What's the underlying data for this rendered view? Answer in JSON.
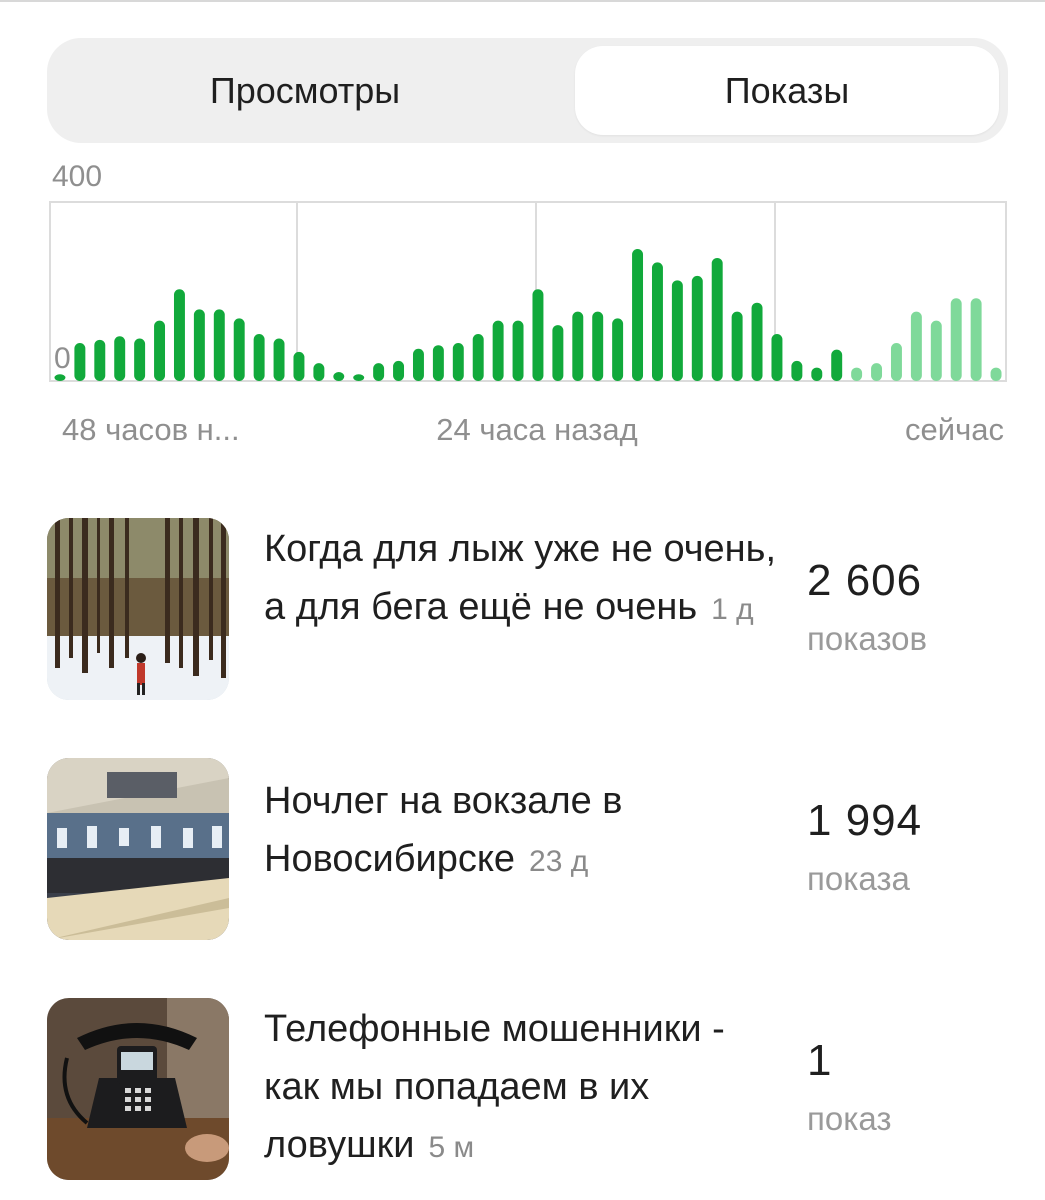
{
  "tabs": {
    "views_label": "Просмотры",
    "shows_label": "Показы",
    "active": "Показы"
  },
  "chart_data": {
    "type": "bar",
    "ylim": [
      0,
      400
    ],
    "y_ticks": [
      "400",
      "0"
    ],
    "x_labels": [
      "48 часов н...",
      "24 часа назад",
      "сейчас"
    ],
    "grid": true,
    "colors": {
      "past": "#11a93b",
      "recent": "#7fd99a"
    },
    "values": [
      15,
      85,
      92,
      100,
      95,
      135,
      205,
      160,
      160,
      140,
      105,
      95,
      65,
      40,
      20,
      15,
      40,
      45,
      72,
      80,
      85,
      105,
      135,
      135,
      205,
      125,
      155,
      155,
      140,
      295,
      265,
      225,
      235,
      275,
      155,
      175,
      105,
      45,
      30,
      70,
      30,
      40,
      85,
      155,
      135,
      185,
      185,
      30
    ],
    "recent_from_index": 40
  },
  "articles": [
    {
      "title": "Когда для лыж уже не очень, а для бега ещё не очень",
      "age": "1 д",
      "value": "2 606",
      "label": "показов",
      "image_icon": "winter-forest-runner-photo"
    },
    {
      "title": "Ночлег на вокзале в Новосибирске",
      "age": "23 д",
      "value": "1 994",
      "label": "показа",
      "image_icon": "railway-station-hall-photo"
    },
    {
      "title": "Телефонные мошенники - как мы попадаем в их ловушки",
      "age": "5 м",
      "value": "1",
      "label": "показ",
      "image_icon": "old-telephone-photo"
    }
  ]
}
